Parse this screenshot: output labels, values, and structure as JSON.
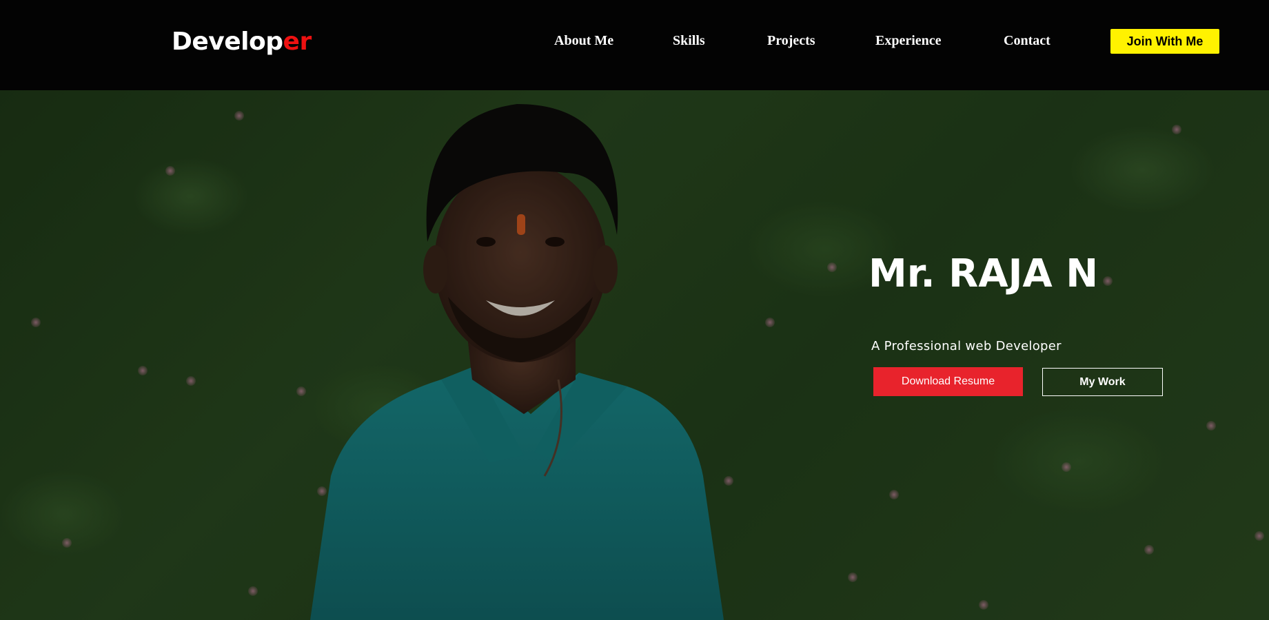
{
  "logo": {
    "main": "Develop",
    "accent": "er"
  },
  "nav": {
    "about": "About Me",
    "skills": "Skills",
    "projects": "Projects",
    "experience": "Experience",
    "contact": "Contact",
    "join": "Join With Me"
  },
  "hero": {
    "name": "Mr. RAJA N",
    "tagline": "A Professional web Developer",
    "primary_button": "Download Resume",
    "secondary_button": "My Work"
  },
  "colors": {
    "navbar_bg": "#030303",
    "logo_accent": "#ee1111",
    "join_button": "#fff200",
    "resume_button": "#e8232c"
  }
}
